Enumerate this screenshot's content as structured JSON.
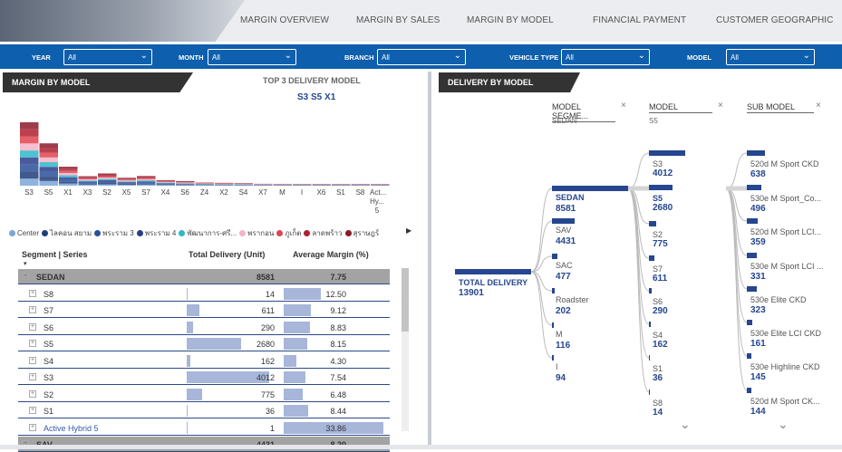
{
  "nav": [
    "MARGIN OVERVIEW",
    "MARGIN BY SALES",
    "MARGIN BY MODEL",
    "FINANCIAL PAYMENT",
    "CUSTOMER GEOGRAPHIC"
  ],
  "filters": [
    {
      "label": "YEAR",
      "value": "All"
    },
    {
      "label": "MONTH",
      "value": "All"
    },
    {
      "label": "BRANCH",
      "value": "All"
    },
    {
      "label": "VEHICLE TYPE",
      "value": "All"
    },
    {
      "label": "MODEL",
      "value": "All"
    }
  ],
  "left": {
    "title": "MARGIN BY MODEL",
    "top3_title": "TOP 3 DELIVERY MODEL",
    "top3_value": "S3 S5 X1",
    "legend": [
      {
        "name": "Center",
        "color": "#7aa6d8"
      },
      {
        "name": "ไลคอน สยาม",
        "color": "#1f3d7a"
      },
      {
        "name": "พระราม 3",
        "color": "#2a4f9c"
      },
      {
        "name": "พระราม 4",
        "color": "#2c3c8c"
      },
      {
        "name": "พัฒนาการ-ศรี...",
        "color": "#2fb7c7"
      },
      {
        "name": "พรากอน",
        "color": "#f4b3c6"
      },
      {
        "name": "ภูเก็ต",
        "color": "#e0444f"
      },
      {
        "name": "ลาดพร้าว",
        "color": "#b11f2f"
      },
      {
        "name": "สุราษฎร์",
        "color": "#8c1a2a"
      }
    ],
    "table": {
      "h1": "Segment | Series",
      "h2": "Total Delivery (Unit)",
      "h3": "Average Margin (%)",
      "rows": [
        {
          "name": "SEDAN",
          "units": "8581",
          "margin": "7.75",
          "group": true
        },
        {
          "name": "S8",
          "units": "14",
          "margin": "12.50"
        },
        {
          "name": "S7",
          "units": "611",
          "margin": "9.12"
        },
        {
          "name": "S6",
          "units": "290",
          "margin": "8.83"
        },
        {
          "name": "S5",
          "units": "2680",
          "margin": "8.15"
        },
        {
          "name": "S4",
          "units": "162",
          "margin": "4.30"
        },
        {
          "name": "S3",
          "units": "4012",
          "margin": "7.54"
        },
        {
          "name": "S2",
          "units": "775",
          "margin": "6.48"
        },
        {
          "name": "S1",
          "units": "36",
          "margin": "8.44"
        },
        {
          "name": "Active Hybrid 5",
          "units": "1",
          "margin": "33.86"
        },
        {
          "name": "SAV",
          "units": "4431",
          "margin": "8.20",
          "group": true
        }
      ]
    }
  },
  "chart_data": {
    "type": "area",
    "categories": [
      "S3",
      "S5",
      "X1",
      "X3",
      "S2",
      "X5",
      "S7",
      "X4",
      "S6",
      "Z4",
      "X2",
      "S4",
      "X7",
      "M",
      "I",
      "X6",
      "S1",
      "S8",
      "Act... Hy... 5"
    ],
    "series_stacked_units": [
      4012,
      2680,
      1200,
      600,
      775,
      500,
      611,
      350,
      290,
      200,
      180,
      162,
      120,
      116,
      94,
      80,
      36,
      14,
      1
    ],
    "note": ""
  },
  "right": {
    "title": "DELIVERY BY MODEL",
    "cols": [
      {
        "label": "MODEL SEGME...",
        "sel": "SEDAN"
      },
      {
        "label": "MODEL",
        "sel": "S5"
      },
      {
        "label": "SUB MODEL",
        "sel": ""
      }
    ],
    "total": {
      "label": "TOTAL DELIVERY",
      "value": "13901"
    },
    "seg": [
      {
        "n": "SEDAN",
        "v": "8581"
      },
      {
        "n": "SAV",
        "v": "4431"
      },
      {
        "n": "SAC",
        "v": "477"
      },
      {
        "n": "Roadster",
        "v": "202"
      },
      {
        "n": "M",
        "v": "116"
      },
      {
        "n": "I",
        "v": "94"
      }
    ],
    "model": [
      {
        "n": "S3",
        "v": "4012"
      },
      {
        "n": "S5",
        "v": "2680"
      },
      {
        "n": "S2",
        "v": "775"
      },
      {
        "n": "S7",
        "v": "611"
      },
      {
        "n": "S6",
        "v": "290"
      },
      {
        "n": "S4",
        "v": "162"
      },
      {
        "n": "S1",
        "v": "36"
      },
      {
        "n": "S8",
        "v": "14"
      }
    ],
    "sub": [
      {
        "n": "520d M Sport CKD",
        "v": "638"
      },
      {
        "n": "530e M Sport_Co...",
        "v": "496"
      },
      {
        "n": "520d M Sport LCI...",
        "v": "359"
      },
      {
        "n": "530e M Sport LCI ...",
        "v": "331"
      },
      {
        "n": "530e Elite CKD",
        "v": "323"
      },
      {
        "n": "530e Elite LCI CKD",
        "v": "161"
      },
      {
        "n": "530e Highline CKD",
        "v": "145"
      },
      {
        "n": "520d M Sport CK...",
        "v": "144"
      }
    ]
  }
}
